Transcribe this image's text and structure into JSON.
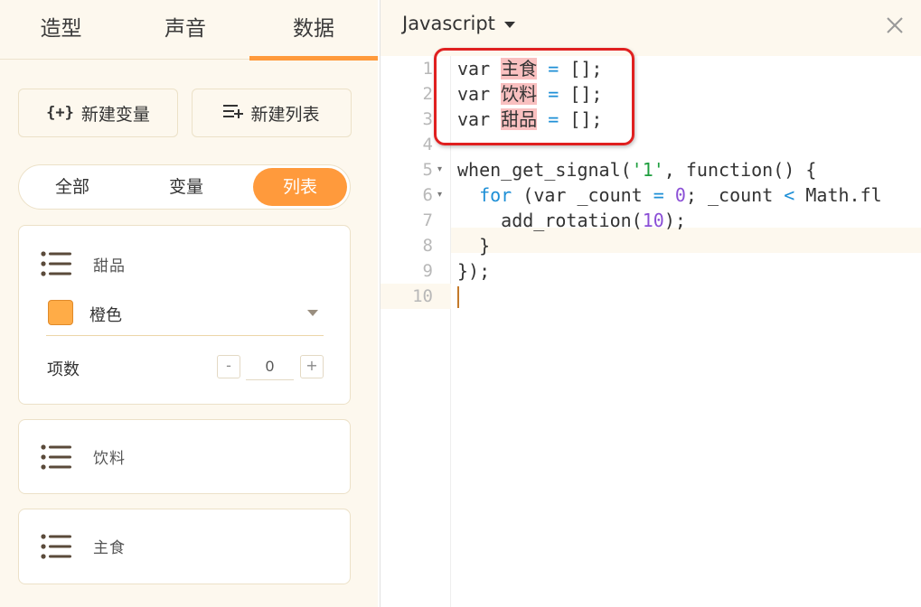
{
  "left_panel": {
    "tabs": [
      "造型",
      "声音",
      "数据"
    ],
    "new_variable_button": "新建变量",
    "new_list_button": "新建列表",
    "new_variable_icon_text": "{+}",
    "filter": [
      "全部",
      "变量",
      "列表"
    ],
    "lists": [
      {
        "name": "甜品",
        "color_label": "橙色",
        "color": "#ffac47",
        "count_label": "项数",
        "count_value": "0",
        "dec_label": "-",
        "inc_label": "+"
      },
      {
        "name": "饮料"
      },
      {
        "name": "主食"
      }
    ]
  },
  "editor": {
    "language": "Javascript",
    "line_numbers": [
      "1",
      "2",
      "3",
      "4",
      "5",
      "6",
      "7",
      "8",
      "9",
      "10"
    ],
    "code": {
      "var_kw": "var",
      "var1": "主食",
      "var2": "饮料",
      "var3": "甜品",
      "assign": "=",
      "empty_array": "[];",
      "fn_call": "when_get_signal(",
      "signal_str": "'1'",
      "fn_rest": ", function() {",
      "for_kw": "for",
      "for_open": " (",
      "count_var": " _count ",
      "zero": "0",
      "semi_count": "; _count ",
      "lt": "<",
      "math_fl": " Math.fl",
      "rotation_call": "add_rotation(",
      "ten": "10",
      "rotation_end": ");",
      "close_brace": "}",
      "close_all": "});"
    }
  },
  "colors": {
    "accent": "#ff9a3c",
    "panel_bg": "#fdf8ee",
    "highlight": "#f9c0c0",
    "annotation": "#e02020"
  }
}
